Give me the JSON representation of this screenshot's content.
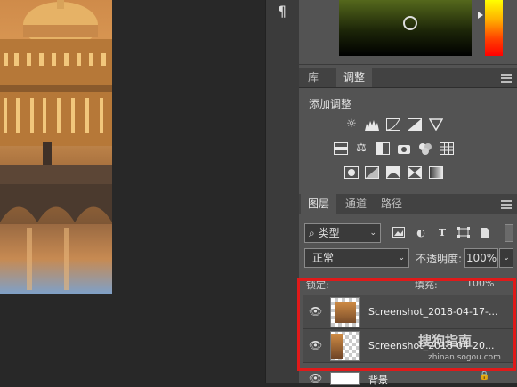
{
  "tools": {
    "paragraph_icon": "¶"
  },
  "adjust_panel": {
    "tabs": [
      {
        "label": "库"
      },
      {
        "label": "调整"
      }
    ],
    "title": "添加调整",
    "rows": [
      [
        "brightness-contrast-icon",
        "levels-icon",
        "curves-icon",
        "exposure-icon",
        "vibrance-icon"
      ],
      [
        "hue-saturation-icon",
        "color-balance-icon",
        "black-white-icon",
        "photo-filter-icon",
        "channel-mixer-icon",
        "color-lookup-icon"
      ],
      [
        "invert-icon",
        "posterize-icon",
        "threshold-icon",
        "selective-color-icon",
        "gradient-map-icon"
      ]
    ]
  },
  "layers_panel": {
    "tabs": [
      {
        "label": "图层"
      },
      {
        "label": "通道"
      },
      {
        "label": "路径"
      }
    ],
    "filter_label": "类型",
    "filter_icons": [
      "pixel-filter-icon",
      "adjustment-filter-icon",
      "type-filter-icon",
      "shape-filter-icon",
      "smart-object-filter-icon"
    ],
    "blend_mode": "正常",
    "opacity_label": "不透明度:",
    "opacity_value": "100%",
    "lock_label": "锁定:",
    "fill_label": "填充:",
    "fill_value": "100%",
    "layers": [
      {
        "name": "Screenshot_2018-04-17-..."
      },
      {
        "name": "Screenshot_2018-04-20..."
      },
      {
        "name": "背景"
      }
    ]
  },
  "watermark": {
    "main": "搜狗指南",
    "sub": "zhinan.sogou.com"
  },
  "colors": {
    "highlight": "#e01a1a",
    "panel_bg": "#535353",
    "tab_bg": "#424242"
  }
}
